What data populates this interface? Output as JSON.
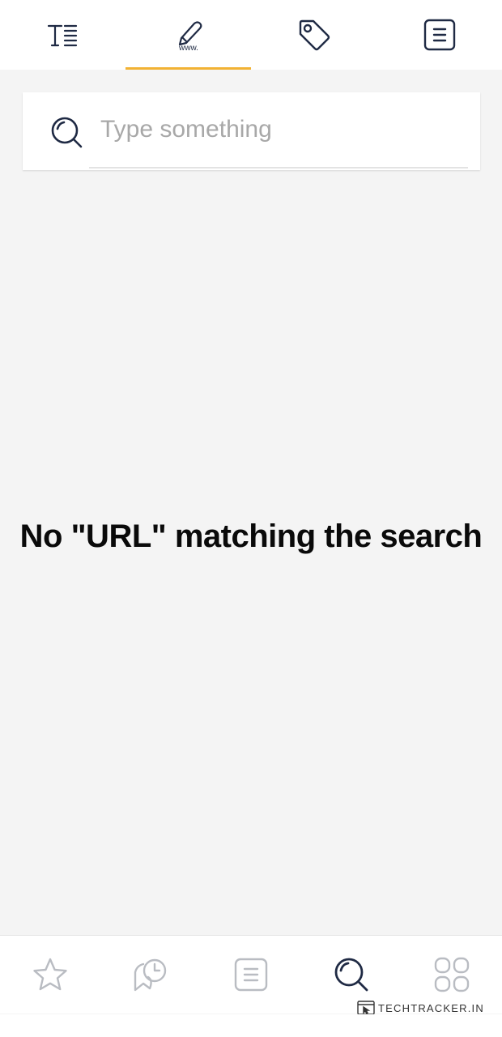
{
  "top_tabs": [
    {
      "name": "tab-text",
      "icon": "text-lines-icon",
      "selected": false
    },
    {
      "name": "tab-url",
      "icon": "pen-www-icon",
      "selected": true
    },
    {
      "name": "tab-tags",
      "icon": "tag-icon",
      "selected": false
    },
    {
      "name": "tab-notes",
      "icon": "note-list-icon",
      "selected": false
    }
  ],
  "search": {
    "placeholder": "Type something",
    "value": ""
  },
  "empty_state": {
    "message": "No \"URL\" matching the search"
  },
  "bottom_nav": [
    {
      "name": "nav-favorites",
      "icon": "star-icon",
      "active": false
    },
    {
      "name": "nav-history",
      "icon": "clock-bookmark-icon",
      "active": false
    },
    {
      "name": "nav-notes",
      "icon": "note-icon",
      "active": false
    },
    {
      "name": "nav-search",
      "icon": "search-icon",
      "active": true
    },
    {
      "name": "nav-apps",
      "icon": "grid-icon",
      "active": false
    }
  ],
  "watermark": {
    "text": "TECHTRACKER.IN"
  },
  "colors": {
    "accent": "#f2b233",
    "icon_dark": "#1f2a44",
    "icon_inactive": "#b9bcc2",
    "background": "#f4f4f4"
  }
}
